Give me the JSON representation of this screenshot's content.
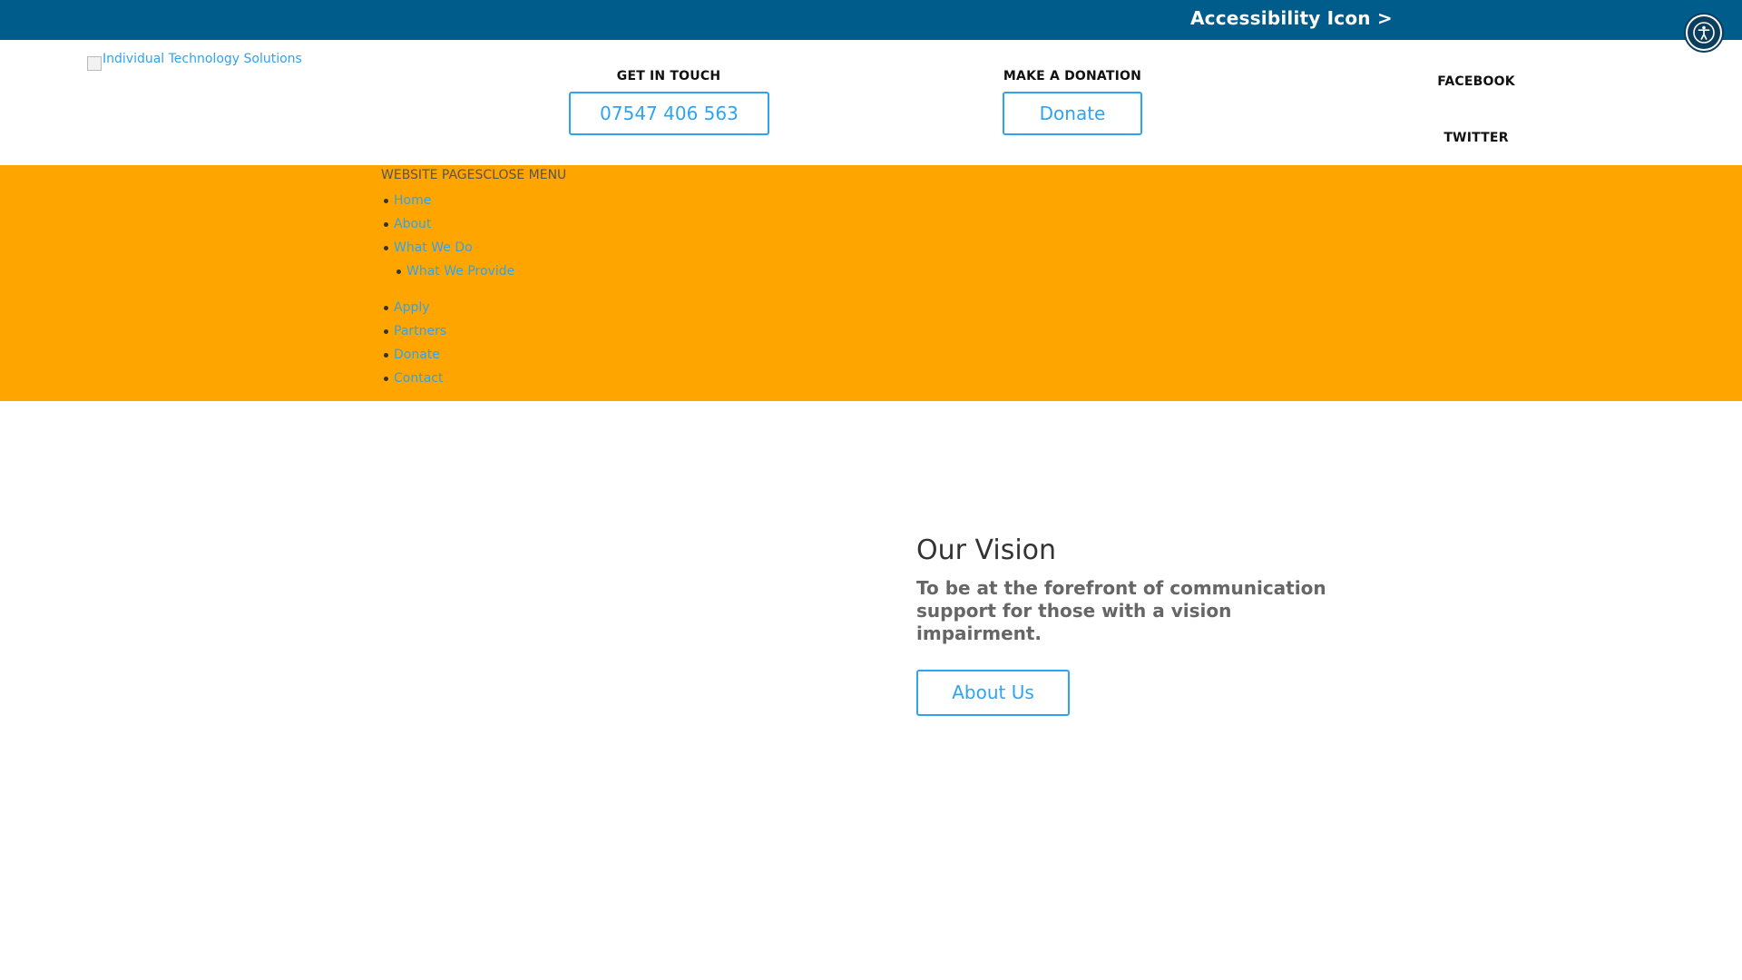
{
  "topbar": {
    "accessibility_text": "Accessibility Icon >",
    "accessibility_button_icon": "accessibility-person-icon"
  },
  "header": {
    "logo_alt": "Individual Technology Solutions",
    "get_in_touch": {
      "label": "GET IN TOUCH",
      "button": "07547 406 563"
    },
    "donation": {
      "label": "MAKE A DONATION",
      "button": "Donate"
    },
    "social": [
      {
        "label": "FACEBOOK",
        "icon": "facebook-icon",
        "glyph": ""
      },
      {
        "label": "TWITTER",
        "icon": "twitter-icon",
        "glyph": ""
      }
    ]
  },
  "menu": {
    "title": "WEBSITE PAGESCLOSE MENU",
    "items": [
      {
        "label": "Home"
      },
      {
        "label": "About"
      },
      {
        "label": "What We Do"
      },
      {
        "label": "What We Provide",
        "sub": true
      },
      {
        "label": "Apply"
      },
      {
        "label": "Partners"
      },
      {
        "label": "Donate"
      },
      {
        "label": "Contact"
      }
    ]
  },
  "vision": {
    "heading": "Our Vision",
    "tagline": "To be at the forefront of communication support for those with a vision impairment.",
    "button": "About Us"
  },
  "colors": {
    "topbar": "#005c8a",
    "menu_band": "#ffa500",
    "link": "#2ea3f2"
  }
}
